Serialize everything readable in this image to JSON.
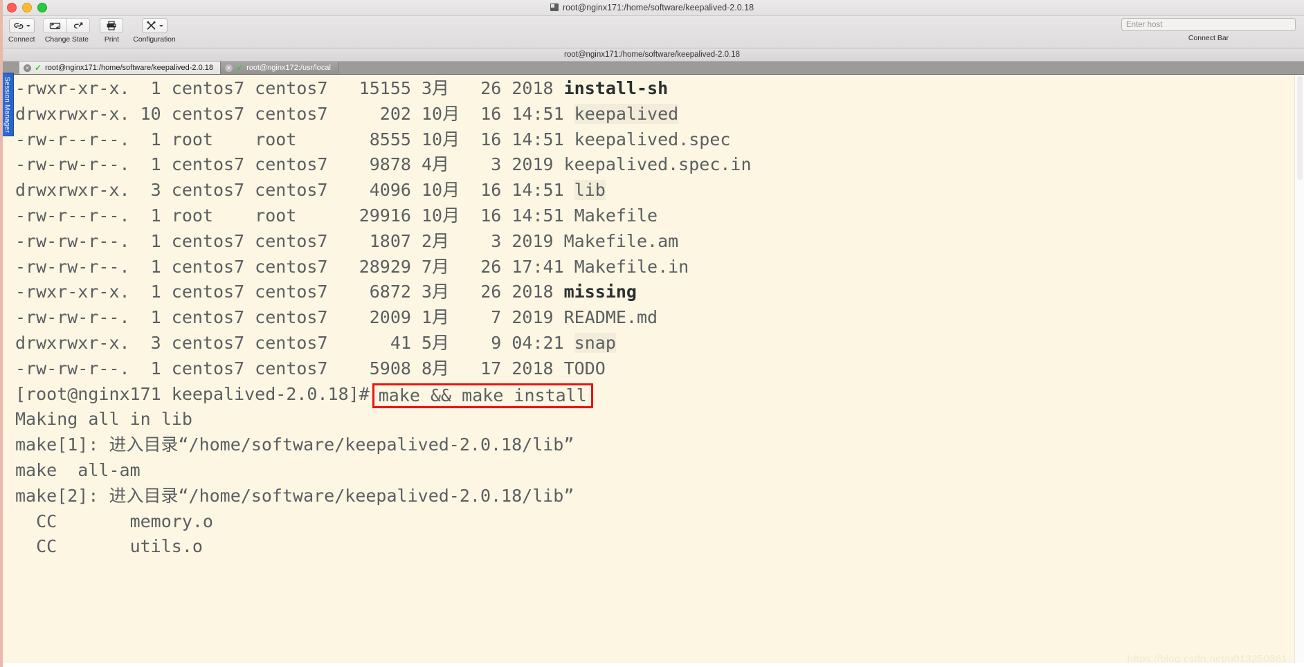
{
  "window": {
    "title": "root@nginx171:/home/software/keepalived-2.0.18",
    "title_icon": "terminal-icon",
    "traffic_lights": [
      "close",
      "minimize",
      "maximize"
    ]
  },
  "toolbar": {
    "items": [
      {
        "label": "Connect",
        "icon": "link-icon",
        "has_caret": true
      },
      {
        "label": "Change State",
        "icon": "sync-icon",
        "icon2": "link-broken-icon",
        "has_caret": false
      },
      {
        "label": "Print",
        "icon": "printer-icon",
        "has_caret": false
      },
      {
        "label": "Configuration",
        "icon": "tools-icon",
        "has_caret": true
      }
    ],
    "connect_bar": {
      "placeholder": "Enter host",
      "value": "",
      "label": "Connect Bar"
    }
  },
  "pathbar": {
    "text": "root@nginx171:/home/software/keepalived-2.0.18"
  },
  "tabs": [
    {
      "label": "root@nginx171:/home/software/keepalived-2.0.18",
      "active": true,
      "status": "connected",
      "close_icon": "close-icon"
    },
    {
      "label": "root@nginx172:/usr/local",
      "active": false,
      "status": "connected",
      "close_icon": "close-icon"
    }
  ],
  "session_rail": {
    "label": "Session Manager",
    "color": "#2f6fd8"
  },
  "terminal": {
    "background": "#fdf6e3",
    "foreground": "#5a5f62",
    "highlight_box_color": "#ee1111",
    "lines": [
      {
        "segments": [
          {
            "text": "-rwxr-xr-x.  1 centos7 centos7   15155 3月   26 2018 ",
            "type": "plain"
          },
          {
            "text": "install-sh",
            "type": "exec"
          }
        ]
      },
      {
        "segments": [
          {
            "text": "drwxrwxr-x. 10 centos7 centos7     202 10月  16 14:51 ",
            "type": "plain"
          },
          {
            "text": "keepalived",
            "type": "dir"
          }
        ]
      },
      {
        "segments": [
          {
            "text": "-rw-r--r--.  1 root    root       8555 10月  16 14:51 keepalived.spec",
            "type": "plain"
          }
        ]
      },
      {
        "segments": [
          {
            "text": "-rw-rw-r--.  1 centos7 centos7    9878 4月    3 2019 keepalived.spec.in",
            "type": "plain"
          }
        ]
      },
      {
        "segments": [
          {
            "text": "drwxrwxr-x.  3 centos7 centos7    4096 10月  16 14:51 ",
            "type": "plain"
          },
          {
            "text": "lib",
            "type": "dir"
          }
        ]
      },
      {
        "segments": [
          {
            "text": "-rw-r--r--.  1 root    root      29916 10月  16 14:51 Makefile",
            "type": "plain"
          }
        ]
      },
      {
        "segments": [
          {
            "text": "-rw-rw-r--.  1 centos7 centos7    1807 2月    3 2019 Makefile.am",
            "type": "plain"
          }
        ]
      },
      {
        "segments": [
          {
            "text": "-rw-rw-r--.  1 centos7 centos7   28929 7月   26 17:41 Makefile.in",
            "type": "plain"
          }
        ]
      },
      {
        "segments": [
          {
            "text": "-rwxr-xr-x.  1 centos7 centos7    6872 3月   26 2018 ",
            "type": "plain"
          },
          {
            "text": "missing",
            "type": "exec"
          }
        ]
      },
      {
        "segments": [
          {
            "text": "-rw-rw-r--.  1 centos7 centos7    2009 1月    7 2019 README.md",
            "type": "plain"
          }
        ]
      },
      {
        "segments": [
          {
            "text": "drwxrwxr-x.  3 centos7 centos7      41 5月    9 04:21 ",
            "type": "plain"
          },
          {
            "text": "snap",
            "type": "dir"
          }
        ]
      },
      {
        "segments": [
          {
            "text": "-rw-rw-r--.  1 centos7 centos7    5908 8月   17 2018 TODO",
            "type": "plain"
          }
        ]
      },
      {
        "segments": [
          {
            "text": "[root@nginx171 keepalived-2.0.18]#",
            "type": "plain"
          },
          {
            "text": "make && make install",
            "type": "boxed"
          }
        ]
      },
      {
        "segments": [
          {
            "text": "Making all in lib",
            "type": "plain"
          }
        ]
      },
      {
        "segments": [
          {
            "text": "make[1]: 进入目录“/home/software/keepalived-2.0.18/lib”",
            "type": "plain"
          }
        ]
      },
      {
        "segments": [
          {
            "text": "make  all-am",
            "type": "plain"
          }
        ]
      },
      {
        "segments": [
          {
            "text": "make[2]: 进入目录“/home/software/keepalived-2.0.18/lib”",
            "type": "plain"
          }
        ]
      },
      {
        "segments": [
          {
            "text": "  CC       memory.o",
            "type": "plain"
          }
        ]
      },
      {
        "segments": [
          {
            "text": "  CC       utils.o",
            "type": "plain"
          }
        ]
      }
    ]
  },
  "watermark": {
    "text": "https://blog.csdn.net/u013250861"
  }
}
